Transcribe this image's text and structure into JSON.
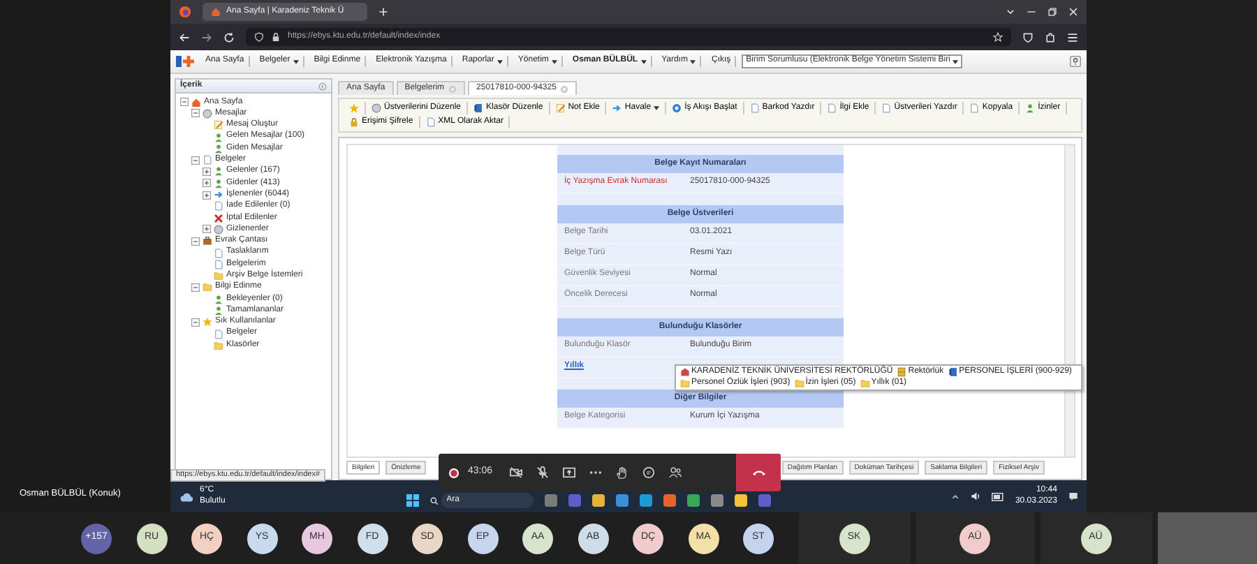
{
  "browser": {
    "tab_title": "Ana Sayfa | Karadeniz Teknik Ü",
    "url": "https://ebys.ktu.edu.tr/default/index/index",
    "status_url": "https://ebys.ktu.edu.tr/default/index/index#"
  },
  "app_menu": [
    {
      "label": "Ana Sayfa",
      "kind": "plain"
    },
    {
      "label": "Belgeler",
      "kind": "menu"
    },
    {
      "label": "Bilgi Edinme",
      "kind": "plain"
    },
    {
      "label": "Elektronik Yazışma",
      "kind": "plain"
    },
    {
      "label": "Raporlar",
      "kind": "menu"
    },
    {
      "label": "Yönetim",
      "kind": "menu"
    },
    {
      "label": "Osman BÜLBÜL",
      "kind": "user"
    },
    {
      "label": "Yardım",
      "kind": "menu"
    },
    {
      "label": "Çıkış",
      "kind": "plain"
    }
  ],
  "role_select": {
    "value": "Birim Sorumlusu (Elektronik Belge Yönetim Sistemi Biri"
  },
  "sidebar": {
    "title": "İçerik",
    "tree": [
      {
        "label": "Ana Sayfa",
        "kind": "home",
        "expanded": true,
        "children": [
          {
            "label": "Mesajlar",
            "kind": "disc",
            "expanded": true,
            "children": [
              {
                "label": "Mesaj Oluştur",
                "kind": "pencil"
              },
              {
                "label": "Gelen Mesajlar (100)",
                "kind": "person"
              },
              {
                "label": "Giden Mesajlar",
                "kind": "person"
              }
            ]
          },
          {
            "label": "Belgeler",
            "kind": "page",
            "expanded": true,
            "children": [
              {
                "label": "Gelenler (167)",
                "kind": "person",
                "expanded": false
              },
              {
                "label": "Gidenler (413)",
                "kind": "person",
                "expanded": false
              },
              {
                "label": "İşlenenler (6044)",
                "kind": "arrow",
                "expanded": false
              },
              {
                "label": "İade Edilenler (0)",
                "kind": "page"
              },
              {
                "label": "İptal Edilenler",
                "kind": "cross"
              },
              {
                "label": "Gizlenenler",
                "kind": "disc",
                "expanded": false
              }
            ]
          },
          {
            "label": "Evrak Çantası",
            "kind": "bag",
            "expanded": true,
            "children": [
              {
                "label": "Taslaklarım",
                "kind": "page"
              },
              {
                "label": "Belgelerim",
                "kind": "page"
              },
              {
                "label": "Arşiv Belge İstemleri",
                "kind": "folder"
              }
            ]
          },
          {
            "label": "Bilgi Edinme",
            "kind": "folder",
            "expanded": true,
            "children": [
              {
                "label": "Bekleyenler (0)",
                "kind": "person"
              },
              {
                "label": "Tamamlananlar",
                "kind": "person"
              }
            ]
          },
          {
            "label": "Sık Kullanılanlar",
            "kind": "star",
            "expanded": true,
            "children": [
              {
                "label": "Belgeler",
                "kind": "page"
              },
              {
                "label": "Klasörler",
                "kind": "folder"
              }
            ]
          }
        ]
      }
    ]
  },
  "doc_tabs": [
    {
      "label": "Ana Sayfa",
      "selected": false,
      "closable": false
    },
    {
      "label": "Belgelerim",
      "selected": false,
      "closable": true
    },
    {
      "label": "25017810-000-94325",
      "selected": true,
      "closable": true
    }
  ],
  "toolbar": [
    {
      "kind": "star"
    },
    {
      "label": "Üstverilerini Düzenle",
      "kind": "disc"
    },
    {
      "label": "Klasör Düzenle",
      "kind": "binder"
    },
    {
      "label": "Not Ekle",
      "kind": "pencil"
    },
    {
      "label": "Havale",
      "kind": "arrow",
      "dropdown": true
    },
    {
      "label": "İş Akışı Başlat",
      "kind": "flow"
    },
    {
      "label": "Barkod Yazdır",
      "kind": "page"
    },
    {
      "label": "İlgi Ekle",
      "kind": "page"
    },
    {
      "label": "Üstverileri Yazdır",
      "kind": "page"
    },
    {
      "label": "Kopyala",
      "kind": "page"
    },
    {
      "label": "İzinler",
      "kind": "person"
    },
    {
      "label": "Erişimi Şifrele",
      "kind": "lock"
    },
    {
      "label": "XML Olarak Aktar",
      "kind": "page"
    }
  ],
  "document": {
    "sections": [
      {
        "title": "Belge Kayıt Numaraları",
        "rows": [
          {
            "label": "İç Yazışma Evrak Numarası",
            "value": "25017810-000-94325",
            "kind": "highlight"
          }
        ]
      },
      {
        "title": "Belge Üstverileri",
        "rows": [
          {
            "label": "Belge Tarihi",
            "value": "03.01.2021",
            "kind": "plain"
          },
          {
            "label": "Belge Türü",
            "value": "Resmi Yazı",
            "kind": "plain"
          },
          {
            "label": "Güvenlik Seviyesi",
            "value": "Normal",
            "kind": "plain"
          },
          {
            "label": "Öncelik Derecesi",
            "value": "Normal",
            "kind": "plain"
          }
        ]
      },
      {
        "title": "Bulunduğu Klasörler",
        "rows": [
          {
            "label": "Bulunduğu Klasör",
            "value": "Bulunduğu Birim",
            "kind": "plain"
          },
          {
            "label": "Yıllık",
            "kind": "link"
          }
        ]
      },
      {
        "title": "Diğer Bilgiler",
        "rows": [
          {
            "label": "Belge Kategorisi",
            "value": "Kurum İçi Yazışma",
            "kind": "plain"
          }
        ]
      }
    ]
  },
  "tooltip": {
    "path": [
      {
        "label": "KARADENİZ TEKNİK ÜNİVERSİTESİ REKTÖRLÜĞÜ",
        "kind": "building"
      },
      {
        "label": "Rektörlük",
        "kind": "cabinet"
      },
      {
        "label": "PERSONEL İŞLERİ (900-929)",
        "kind": "binder"
      },
      {
        "label": "Personel Özlük İşleri (903)",
        "kind": "folder"
      },
      {
        "label": "İzin İşleri (05)",
        "kind": "folder"
      },
      {
        "label": "Yıllık (01)",
        "kind": "folder"
      }
    ]
  },
  "bottom_tabs": {
    "left": [
      {
        "label": "Bilgileri",
        "selected": true
      },
      {
        "label": "Önizleme",
        "selected": false
      }
    ],
    "right": [
      {
        "label": "Dağıtım Planları",
        "selected": false
      },
      {
        "label": "Doküman Tarihçesi",
        "selected": false
      },
      {
        "label": "Saklama Bilgileri",
        "selected": false
      },
      {
        "label": "Fiziksel Arşiv",
        "selected": false
      }
    ]
  },
  "taskbar": {
    "temperature": "6°C",
    "weather": "Bulutlu",
    "search": {
      "placeholder": "Ara"
    },
    "time": "10:44",
    "date": "30.03.2023"
  },
  "meeting": {
    "timer": "43:06",
    "presenter": "Osman BÜLBÜL (Konuk)",
    "participants": [
      {
        "initials": "+157",
        "color": "#6264a7"
      },
      {
        "initials": "RU",
        "color": "#d5e0c3"
      },
      {
        "initials": "HÇ",
        "color": "#f2d0c2"
      },
      {
        "initials": "YS",
        "color": "#c8daee"
      },
      {
        "initials": "MH",
        "color": "#e8c8df"
      },
      {
        "initials": "FD",
        "color": "#cfe0ea"
      },
      {
        "initials": "SD",
        "color": "#e9d6c4"
      },
      {
        "initials": "EP",
        "color": "#c8d5ef"
      },
      {
        "initials": "AA",
        "color": "#d7e3cb"
      },
      {
        "initials": "AB",
        "color": "#cfdde8"
      },
      {
        "initials": "DÇ",
        "color": "#f1cccc"
      },
      {
        "initials": "MA",
        "color": "#f2e0a6"
      },
      {
        "initials": "ST",
        "color": "#c6d3ee"
      }
    ],
    "tiles": [
      {
        "initials": "SK",
        "color": "#d7e3cb"
      },
      {
        "initials": "AÜ",
        "color": "#f1cccc"
      },
      {
        "initials": "AÜ",
        "color": "#d7e3cb"
      }
    ]
  }
}
